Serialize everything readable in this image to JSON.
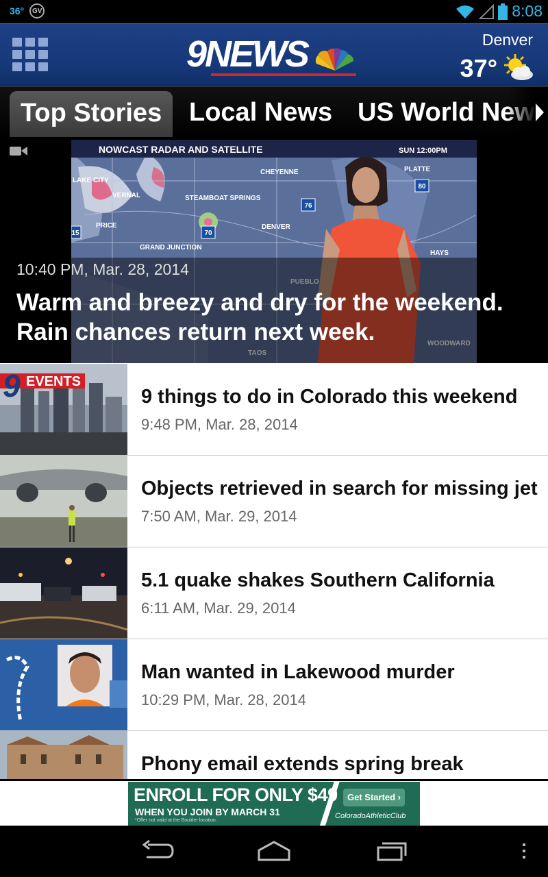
{
  "status_bar": {
    "temperature_badge": "36°",
    "gv_badge": "GV",
    "time": "8:08",
    "icons": [
      "wifi-icon",
      "signal-icon",
      "battery-icon"
    ]
  },
  "header": {
    "logo_text": "9NEWS",
    "city": "Denver",
    "temperature": "37°",
    "weather_icon": "sun-cloud-icon",
    "menu_icon": "grid-menu-icon",
    "colors": {
      "header_blue": "#1e3f85",
      "logo_red": "#d8232a"
    }
  },
  "tabs": [
    {
      "label": "Top Stories",
      "active": true
    },
    {
      "label": "Local News",
      "active": false
    },
    {
      "label": "US World News",
      "active": false
    }
  ],
  "hero": {
    "media_icon": "video-camera-icon",
    "time": "10:40 PM, Mar. 28, 2014",
    "title": "Warm and breezy and dry for the weekend. Rain chances return next week.",
    "image_caption": "NOWCAST RADAR AND SATELLITE",
    "image_stamp": "SUN 12:00PM",
    "map_labels": [
      "CHEYENNE",
      "LAKE CITY",
      "VERNAL",
      "STEAMBOAT SPRINGS",
      "DENVER",
      "PRICE",
      "GRAND JUNCTION",
      "PUEBLO",
      "PLATTE",
      "HAYS",
      "TAOS",
      "WOODWARD"
    ],
    "highway_shields": [
      "76",
      "70",
      "80",
      "15"
    ]
  },
  "stories": [
    {
      "title": "9 things to do in Colorado this weekend",
      "time": "9:48 PM, Mar. 28, 2014",
      "thumb_label": "EVENTS"
    },
    {
      "title": "Objects retrieved in search for missing jet",
      "time": "7:50 AM, Mar. 29, 2014"
    },
    {
      "title": "5.1 quake shakes Southern California",
      "time": "6:11 AM, Mar. 29, 2014"
    },
    {
      "title": "Man wanted in Lakewood murder",
      "time": "10:29 PM, Mar. 28, 2014"
    },
    {
      "title": "Phony email extends spring break",
      "time": ""
    }
  ],
  "ad": {
    "headline": "ENROLL FOR ONLY $49",
    "subline": "WHEN YOU JOIN BY MARCH 31",
    "fine_print": "*Offer not valid at the Boulder location.",
    "cta": "Get Started ›",
    "brand": "ColoradoAthleticClub"
  },
  "nav": [
    "back-icon",
    "home-icon",
    "recent-apps-icon",
    "overflow-menu-icon"
  ]
}
